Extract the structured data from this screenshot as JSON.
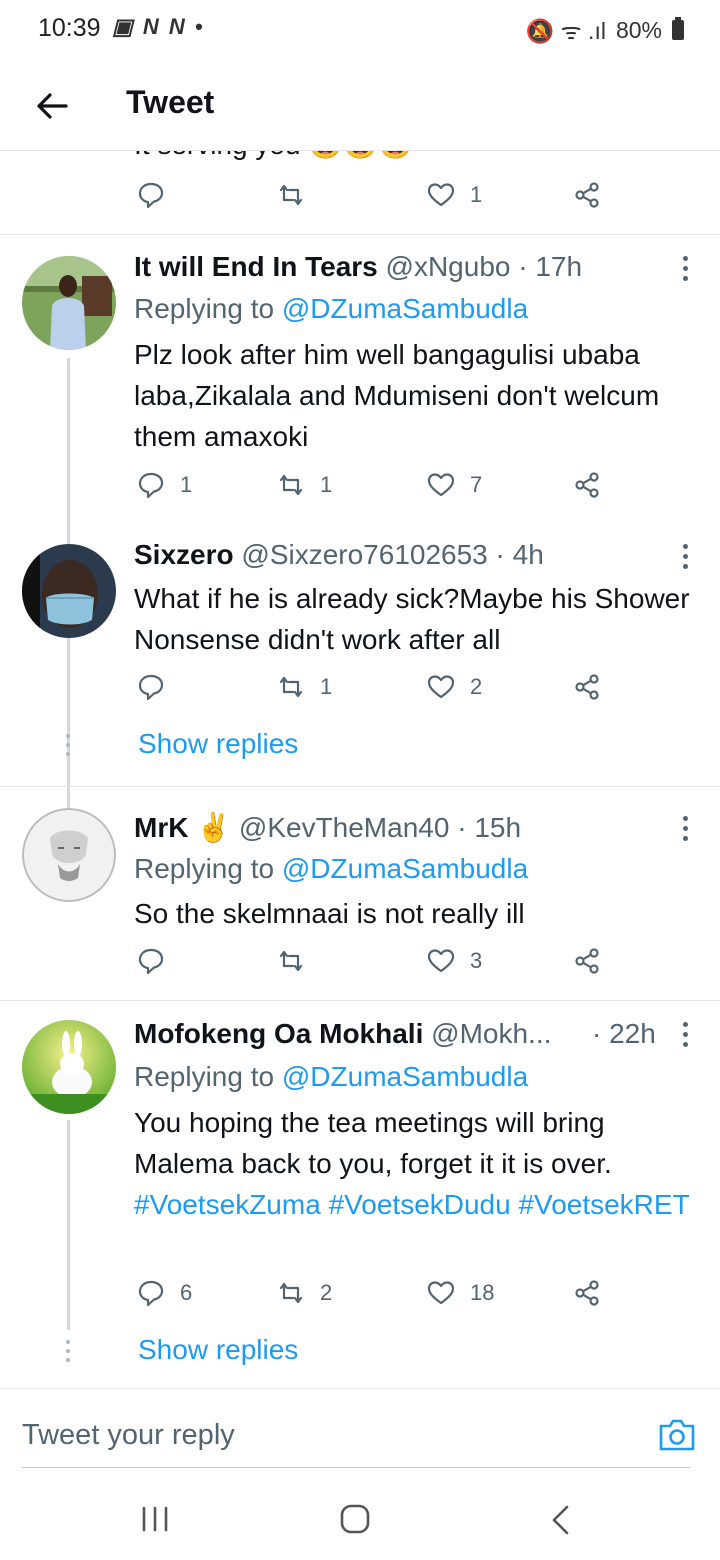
{
  "status_bar": {
    "time": "10:39",
    "left_icons": "▣ N N •",
    "right_icons": "🔕 ᯤ .ıl",
    "battery": "80%"
  },
  "header": {
    "title": "Tweet"
  },
  "partial_tweet": {
    "clipped_text": "It serving you 😂😂😂",
    "replies": "",
    "retweets": "",
    "likes": "1"
  },
  "tweets": [
    {
      "name": "It will End In Tears",
      "handle": "@xNgubo",
      "time": "· 17h",
      "replying_prefix": "Replying to ",
      "replying_to": "@DZumaSambudla",
      "text": "Plz look after him well bangagulisi ubaba laba,Zikalala and Mdumiseni don't welcum them amaxoki",
      "replies": "1",
      "retweets": "1",
      "likes": "7"
    },
    {
      "name": "Sixzero",
      "handle": "@Sixzero76102653",
      "time": "· 4h",
      "text": "What if he is already sick?Maybe his Shower Nonsense didn't  work after all",
      "replies": "",
      "retweets": "1",
      "likes": "2",
      "show_replies": "Show replies"
    },
    {
      "name": "MrK",
      "emoji": "✌️",
      "handle": "@KevTheMan40",
      "time": "· 15h",
      "replying_prefix": "Replying to ",
      "replying_to": "@DZumaSambudla",
      "text": "So the skelmnaai is not really ill",
      "replies": "",
      "retweets": "",
      "likes": "3"
    },
    {
      "name": "Mofokeng Oa Mokhali",
      "handle": "@Mokh...",
      "time": "· 22h",
      "replying_prefix": "Replying to ",
      "replying_to": "@DZumaSambudla",
      "text_plain": "You hoping the tea  meetings will bring Malema back to you, forget it it is over.",
      "hashtags": [
        "#VoetsekZuma",
        "#VoetsekDudu",
        "#VoetsekRET"
      ],
      "replies": "6",
      "retweets": "2",
      "likes": "18",
      "show_replies": "Show replies"
    }
  ],
  "composer": {
    "placeholder": "Tweet your reply"
  },
  "colors": {
    "link": "#1d9bf0",
    "secondary_text": "#536471",
    "divider": "#e6e6e6"
  },
  "icons": [
    "back-arrow-icon",
    "reply-icon",
    "retweet-icon",
    "like-icon",
    "share-icon",
    "more-vertical-icon",
    "camera-icon",
    "recents-icon",
    "home-icon",
    "nav-back-icon"
  ]
}
